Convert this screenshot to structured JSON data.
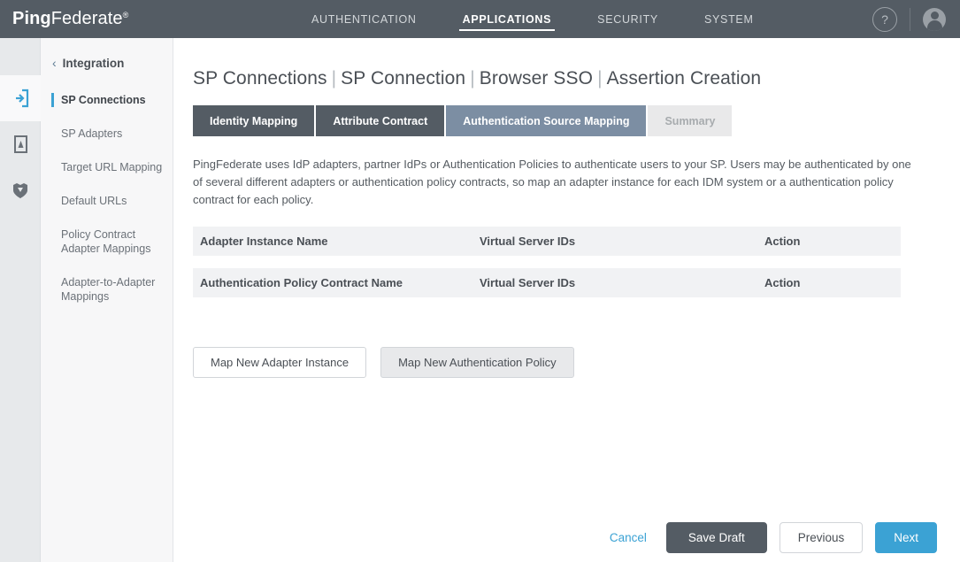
{
  "header": {
    "brand_bold": "Ping",
    "brand_regular": "Federate",
    "brand_mark": "®",
    "nav": [
      {
        "label": "AUTHENTICATION",
        "active": false
      },
      {
        "label": "APPLICATIONS",
        "active": true
      },
      {
        "label": "SECURITY",
        "active": false
      },
      {
        "label": "SYSTEM",
        "active": false
      }
    ],
    "help_icon": "help-question-icon",
    "help_glyph": "?",
    "avatar_icon": "user-avatar-icon",
    "bar_color": "#545c64"
  },
  "rail": {
    "items": [
      {
        "name": "applications-rail-icon",
        "active": true
      },
      {
        "name": "identity-provider-rail-icon",
        "active": false
      },
      {
        "name": "security-shield-rail-icon",
        "active": false
      }
    ],
    "active_color": "#3ba2d4",
    "bg_color": "#e7e9eb"
  },
  "sidebar": {
    "back_chevron": "‹",
    "section": "Integration",
    "items": [
      {
        "label": "SP Connections",
        "active": true
      },
      {
        "label": "SP Adapters",
        "active": false
      },
      {
        "label": "Target URL Mapping",
        "active": false
      },
      {
        "label": "Default URLs",
        "active": false
      },
      {
        "label": "Policy Contract Adapter Mappings",
        "active": false
      },
      {
        "label": "Adapter-to-Adapter Mappings",
        "active": false
      }
    ]
  },
  "main": {
    "breadcrumb": [
      "SP Connections",
      "SP Connection",
      "Browser SSO",
      "Assertion Creation"
    ],
    "breadcrumb_separator": "|",
    "tabs": [
      {
        "label": "Identity Mapping",
        "state": "done"
      },
      {
        "label": "Attribute Contract",
        "state": "done"
      },
      {
        "label": "Authentication Source Mapping",
        "state": "current"
      },
      {
        "label": "Summary",
        "state": "disabled"
      }
    ],
    "description": "PingFederate uses IdP adapters, partner IdPs or Authentication Policies to authenticate users to your SP. Users may be authenticated by one of several different adapters or authentication policy contracts, so map an adapter instance for each IDM system or a authentication policy contract for each policy.",
    "tables": [
      {
        "name": "adapter-instance-table",
        "columns": [
          "Adapter Instance Name",
          "Virtual Server IDs",
          "Action"
        ],
        "rows": []
      },
      {
        "name": "authentication-policy-contract-table",
        "columns": [
          "Authentication Policy Contract Name",
          "Virtual Server IDs",
          "Action"
        ],
        "rows": []
      }
    ],
    "map_buttons": [
      {
        "label": "Map New Adapter Instance",
        "hovered": false
      },
      {
        "label": "Map New Authentication Policy",
        "hovered": true
      }
    ]
  },
  "footer": {
    "cancel": "Cancel",
    "save_draft": "Save Draft",
    "previous": "Previous",
    "next": "Next",
    "accent_color": "#3ba2d4",
    "dark_color": "#545c64"
  }
}
